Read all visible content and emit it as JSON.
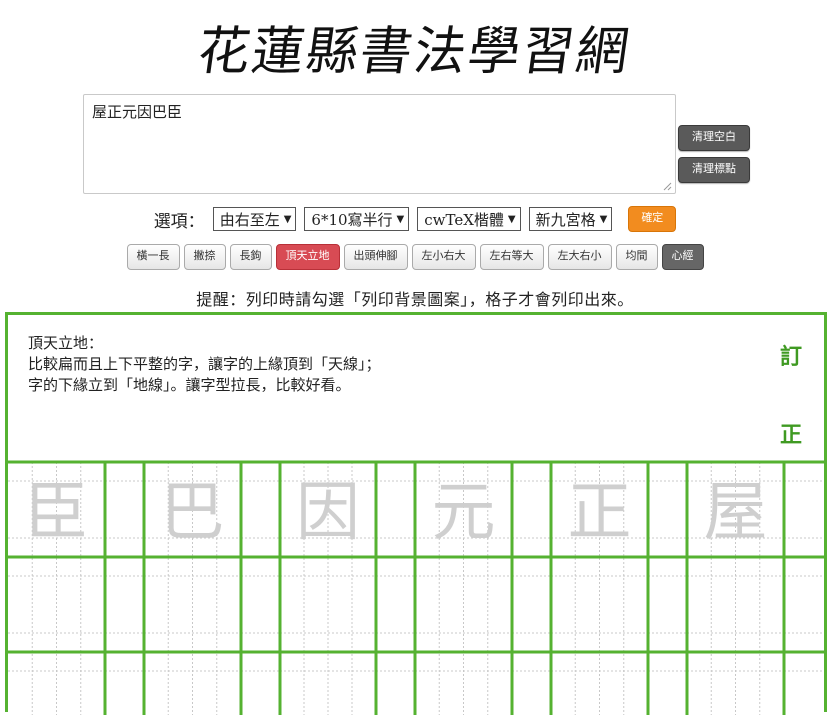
{
  "site_title": "花蓮縣書法學習網",
  "input": {
    "value": "屋正元因巴臣"
  },
  "side_buttons": {
    "clear_space": "清理空白",
    "clear_punct": "清理標點"
  },
  "options": {
    "label": "選項：",
    "direction": "由右至左",
    "layout": "6*10寫半行",
    "font": "cwTeX楷體",
    "grid": "新九宮格",
    "confirm": "確定"
  },
  "strokes": [
    {
      "label": "橫一長"
    },
    {
      "label": "撇捺"
    },
    {
      "label": "長鉤"
    },
    {
      "label": "頂天立地"
    },
    {
      "label": "出頭伸腳"
    },
    {
      "label": "左小右大"
    },
    {
      "label": "左右等大"
    },
    {
      "label": "左大右小"
    },
    {
      "label": "均間"
    },
    {
      "label": "心經"
    }
  ],
  "hint": "提醒：列印時請勾選「列印背景圖案」，格子才會列印出來。",
  "sheet": {
    "note_title": "頂天立地：",
    "note_line1": "比較扁而且上下平整的字，讓字的上緣頂到「天線」；",
    "note_line2": "字的下緣立到「地線」。讓字型拉長，比較好看。",
    "stamp_top": "訂",
    "stamp_bottom": "正",
    "chars": [
      "臣",
      "巴",
      "因",
      "元",
      "正",
      "屋"
    ]
  },
  "colors": {
    "grid_green": "#55b231",
    "active_red": "#d84b54",
    "confirm_orange": "#f28c1f"
  }
}
